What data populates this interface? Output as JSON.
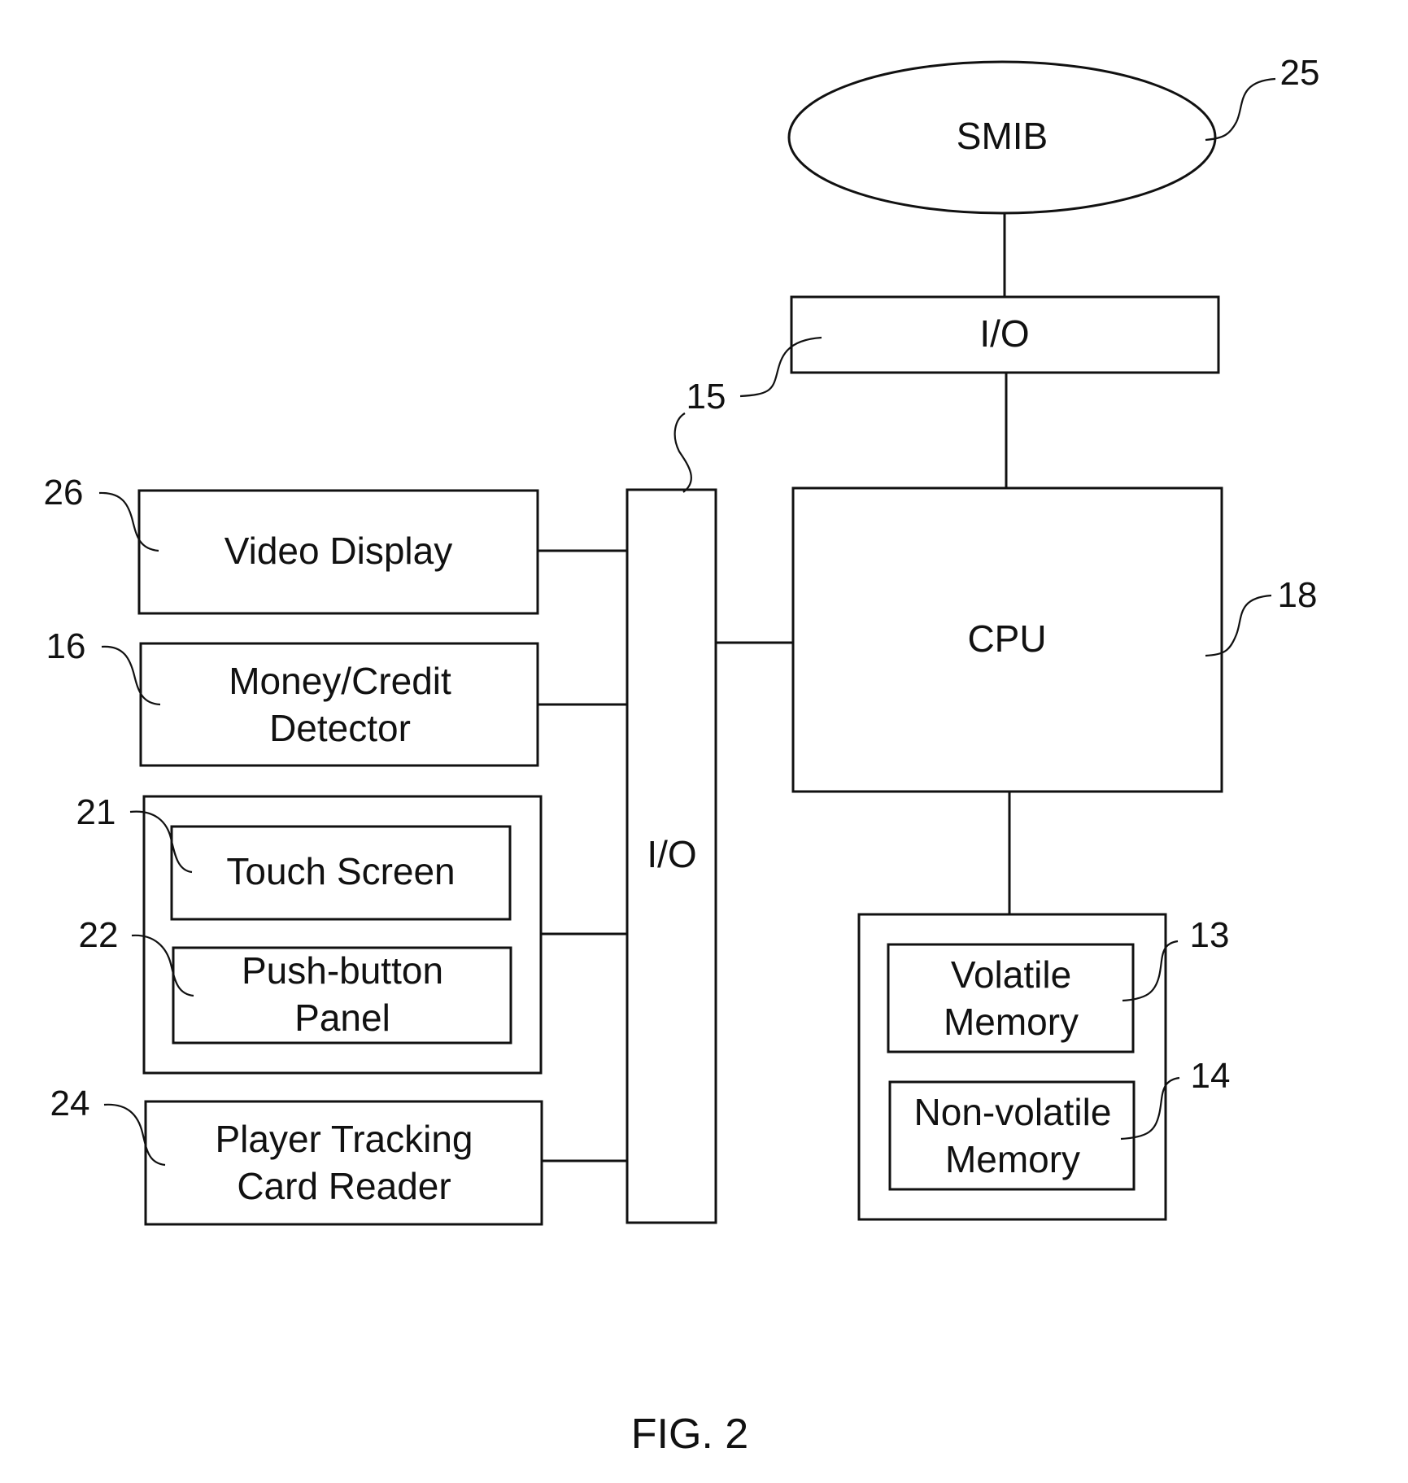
{
  "figure": {
    "caption": "FIG. 2",
    "nodes": {
      "smib": {
        "label": "SMIB",
        "ref": "25"
      },
      "io_top": {
        "label": "I/O",
        "ref": "15"
      },
      "cpu": {
        "label": "CPU",
        "ref": "18"
      },
      "io_bar": {
        "label": "I/O"
      },
      "video_display": {
        "label": "Video Display",
        "ref": "26"
      },
      "money_credit": {
        "label": "Money/Credit\nDetector",
        "ref": "16"
      },
      "touch_screen": {
        "label": "Touch Screen",
        "ref": "21"
      },
      "push_button": {
        "label": "Push-button\nPanel",
        "ref": "22"
      },
      "player_tracking": {
        "label": "Player Tracking\nCard Reader",
        "ref": "24"
      },
      "volatile_memory": {
        "label": "Volatile\nMemory",
        "ref": "13"
      },
      "nonvolatile_memory": {
        "label": "Non-volatile\nMemory",
        "ref": "14"
      }
    }
  }
}
